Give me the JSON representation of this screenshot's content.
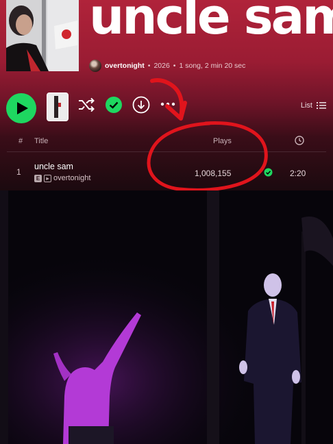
{
  "album": {
    "title": "uncle sam",
    "artist": "overtonight",
    "year": "2026",
    "summary": "1 song, 2 min 20 sec",
    "separator": "•"
  },
  "controls": {
    "list_label": "List",
    "more_label": "···"
  },
  "columns": {
    "number": "#",
    "title": "Title",
    "plays": "Plays"
  },
  "tracks": [
    {
      "number": "1",
      "title": "uncle sam",
      "explicit_badge": "E",
      "artist": "overtonight",
      "plays": "1,008,155",
      "duration": "2:20"
    }
  ],
  "icons": {
    "play": "play-icon",
    "shuffle": "shuffle-icon",
    "saved": "check-circle-icon",
    "download": "download-icon",
    "more": "more-icon",
    "list": "list-icon",
    "duration": "clock-icon",
    "video_badge": "video-icon"
  },
  "colors": {
    "accent_green": "#1ed760",
    "header_red": "#b0233a",
    "annotation_red": "#e0141c",
    "video_purple": "#b33ad6"
  }
}
